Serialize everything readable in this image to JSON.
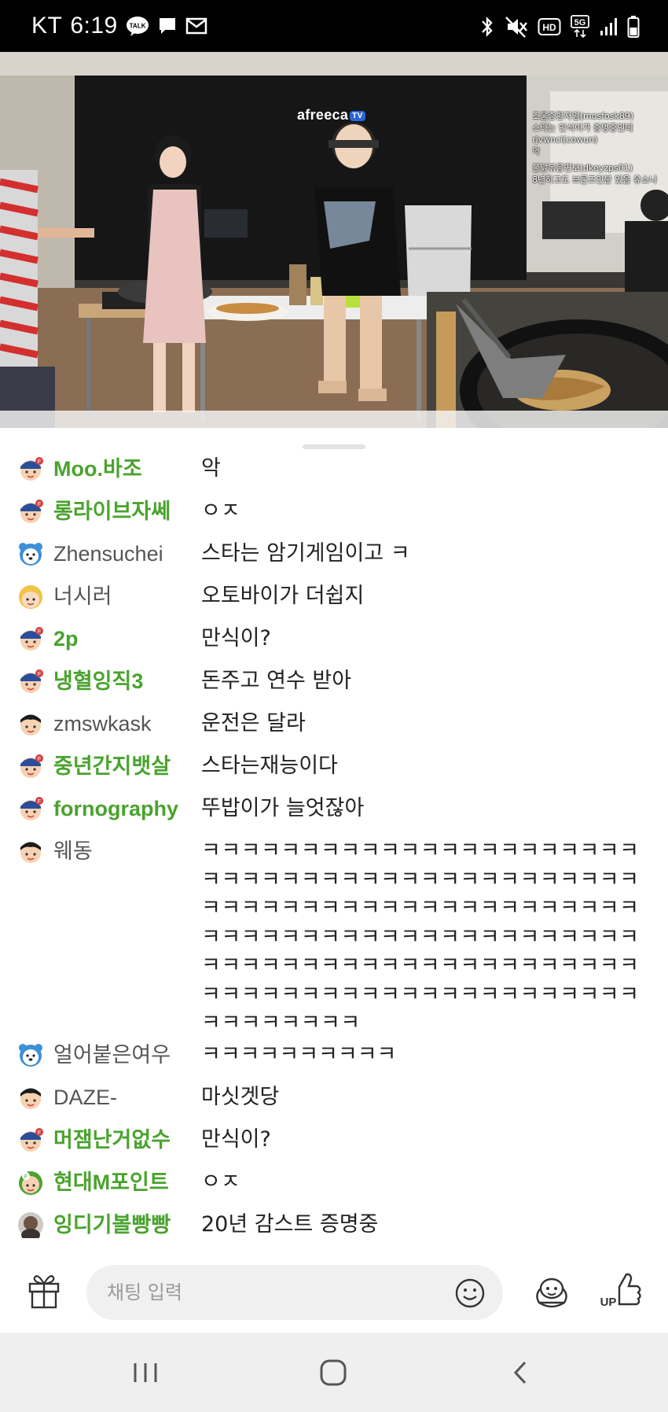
{
  "status_bar": {
    "carrier": "KT",
    "time": "6:19",
    "talk_badge": "TALK",
    "hd_badge": "HD",
    "network": "5G"
  },
  "stream": {
    "brand": "afreeca",
    "brand_suffix": "TV",
    "overlay_chat": [
      "조울증환자임(mosfosk89)",
      "스타는 인식이가 증명중인데",
      "rjvwnci(cowun)",
      "악",
      "",
      "불닭볶음면보(dkeyzps01)",
      "8년하고도 브론즈인분 있음 유소나"
    ]
  },
  "chat": [
    {
      "avatar": "fan-avatar",
      "nick": "Moo.바조",
      "fan": true,
      "message": "악"
    },
    {
      "avatar": "fan-avatar",
      "nick": "롱라이브자쎄",
      "fan": true,
      "message": "ㅇㅈ"
    },
    {
      "avatar": "bear-avatar",
      "nick": "Zhensuchei",
      "fan": false,
      "message": "스타는 암기게임이고 ㅋ"
    },
    {
      "avatar": "blonde-avatar",
      "nick": "너시러",
      "fan": false,
      "message": "오토바이가 더쉽지"
    },
    {
      "avatar": "fan-avatar",
      "nick": "2p",
      "fan": true,
      "message": "만식이?"
    },
    {
      "avatar": "fan-avatar",
      "nick": "냉혈잉직3",
      "fan": true,
      "message": "돈주고 연수 받아"
    },
    {
      "avatar": "default-avatar",
      "nick": "zmswkask",
      "fan": false,
      "message": "운전은 달라"
    },
    {
      "avatar": "fan-avatar",
      "nick": "중년간지뱃살",
      "fan": true,
      "message": "스타는재능이다"
    },
    {
      "avatar": "fan-avatar",
      "nick": "fornography",
      "fan": true,
      "message": "뚜밥이가 늘엇잖아"
    },
    {
      "avatar": "default-avatar",
      "nick": "웨동",
      "fan": false,
      "message": "ㅋㅋㅋㅋㅋㅋㅋㅋㅋㅋㅋㅋㅋㅋㅋㅋㅋㅋㅋㅋㅋㅋㅋㅋㅋㅋㅋㅋㅋㅋㅋㅋㅋㅋㅋㅋㅋㅋㅋㅋㅋㅋㅋㅋㅋㅋㅋㅋㅋㅋㅋㅋㅋㅋㅋㅋㅋㅋㅋㅋㅋㅋㅋㅋㅋㅋㅋㅋㅋㅋㅋㅋㅋㅋㅋㅋㅋㅋㅋㅋㅋㅋㅋㅋㅋㅋㅋㅋㅋㅋㅋㅋㅋㅋㅋㅋㅋㅋㅋㅋㅋㅋㅋㅋㅋㅋㅋㅋㅋㅋㅋㅋㅋㅋㅋㅋㅋㅋㅋㅋㅋㅋㅋㅋㅋㅋㅋㅋㅋㅋㅋㅋㅋㅋㅋㅋㅋㅋㅋㅋ",
      "long": true
    },
    {
      "avatar": "bear-avatar",
      "nick": "얼어붙은여우",
      "fan": false,
      "message": "ㅋㅋㅋㅋㅋㅋㅋㅋㅋㅋ"
    },
    {
      "avatar": "default-avatar",
      "nick": "DAZE-",
      "fan": false,
      "message": "마싯겟당"
    },
    {
      "avatar": "fan-avatar",
      "nick": "머잼난거없수",
      "fan": true,
      "message": "만식이?"
    },
    {
      "avatar": "green-fan-avatar",
      "nick": "현대M포인트",
      "fan": true,
      "message": "ㅇㅈ"
    },
    {
      "avatar": "photo-avatar",
      "nick": "잉디기볼빵빵",
      "fan": true,
      "message": "20년 감스트 증명중"
    }
  ],
  "input": {
    "placeholder": "채팅 입력",
    "up_label": "UP"
  },
  "colors": {
    "fan_nick": "#4aa32e",
    "normal_nick": "#555555",
    "input_bg": "#f0f0f1",
    "nav_bg": "#efeff0"
  }
}
